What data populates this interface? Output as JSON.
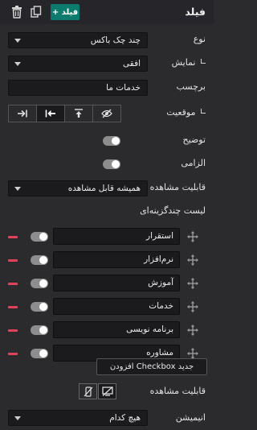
{
  "header": {
    "title": "فیلد",
    "add_label": "+ فیلد",
    "icons": [
      "copy-icon",
      "trash-icon"
    ]
  },
  "type": {
    "label": "نوع",
    "value": "چند چک باکس"
  },
  "display": {
    "label": "نمایش",
    "value": "افقی"
  },
  "caption": {
    "label": "برچسب",
    "value": "خدمات ما"
  },
  "position": {
    "label": "موقعیت",
    "options": [
      "eye-slash-icon",
      "arrow-up-icon",
      "arrow-left-icon",
      "arrow-right-to-bar-icon"
    ],
    "selected_index": 2
  },
  "description": {
    "label": "توضیح",
    "enabled": true
  },
  "required": {
    "label": "الزامی",
    "enabled": true
  },
  "visibility": {
    "label": "قابلیت مشاهده",
    "value": "همیشه قابل مشاهده"
  },
  "checkbox_list": {
    "label": "لیست چندگزینه‌ای",
    "items": [
      {
        "label": "استقرار"
      },
      {
        "label": "نرم‌افزار"
      },
      {
        "label": "آموزش"
      },
      {
        "label": "خدمات"
      },
      {
        "label": "برنامه نویسی"
      },
      {
        "label": "مشاوره"
      }
    ],
    "add_label": "افزودن Checkbox جدید"
  },
  "device_visibility": {
    "label": "قابلیت مشاهده",
    "options": [
      "desktop-off-icon",
      "mobile-off-icon"
    ]
  },
  "animation": {
    "label": "انیمیشن",
    "value": "هیچ کدام"
  },
  "colors": {
    "accent": "#0d7a6e",
    "remove": "#e0445c",
    "background": "#2b2b2d"
  }
}
